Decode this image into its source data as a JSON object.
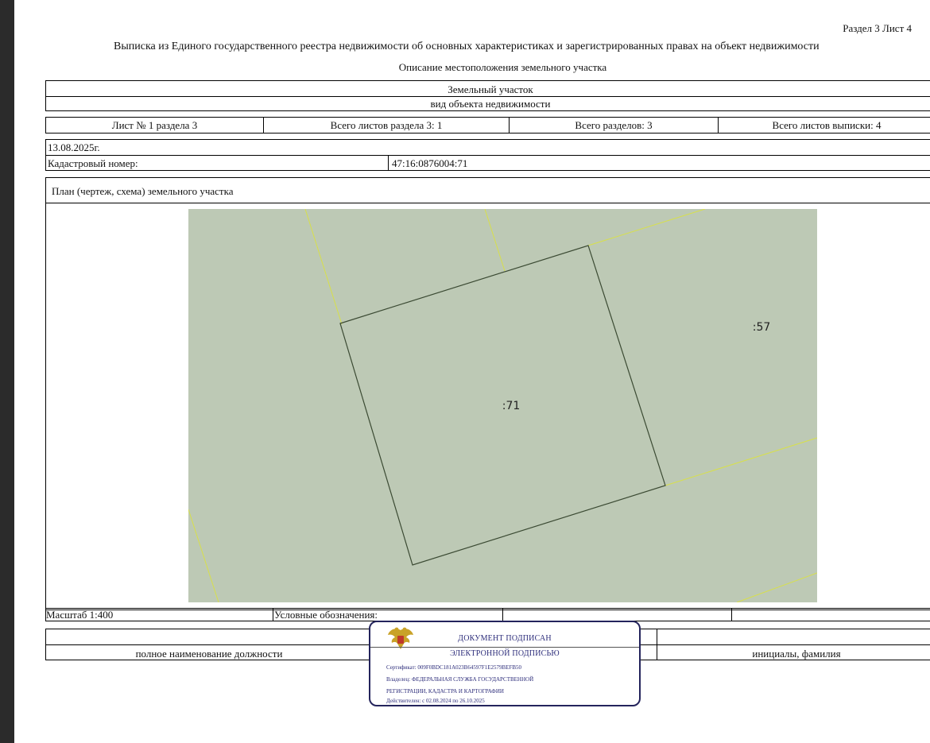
{
  "header": {
    "section_sheet": "Раздел 3   Лист 4",
    "title": "Выписка из Единого государственного реестра недвижимости об основных характеристиках и зарегистрированных правах на объект недвижимости",
    "subtitle": "Описание местоположения земельного участка"
  },
  "object": {
    "type": "Земельный участок",
    "type_caption": "вид объекта недвижимости"
  },
  "sheets": {
    "sheet_no": "Лист № 1 раздела 3",
    "total_section_sheets": "Всего листов раздела 3: 1",
    "total_sections": "Всего разделов: 3",
    "total_sheets": "Всего листов выписки: 4"
  },
  "date": "13.08.2025г.",
  "cadastral": {
    "label": "Кадастровый номер:",
    "value": "47:16:0876004:71"
  },
  "plan": {
    "title": "План (чертеж, схема) земельного участка",
    "parcel_main_label": ":71",
    "parcel_neighbor_label": ":57",
    "colors": {
      "map_fill": "#bdc9b5",
      "parcel_outline": "#3b4a33",
      "boundary_lines": "#d8e04a"
    }
  },
  "footer": {
    "scale": "Масштаб 1:400",
    "legend_label": "Условные обозначения:",
    "position_caption": "полное наименование должности",
    "name_caption": "инициалы, фамилия"
  },
  "stamp": {
    "emblem_icon": "double-headed-eagle-emblem",
    "line1": "ДОКУМЕНТ ПОДПИСАН",
    "line2": "ЭЛЕКТРОННОЙ ПОДПИСЬЮ",
    "certificate": "Сертификат: 009F0BDC181A023B64597F1E2579BEFB50",
    "owner_line1": "Владелец: ФЕДЕРАЛЬНАЯ СЛУЖБА ГОСУДАРСТВЕННОЙ",
    "owner_line2": "РЕГИСТРАЦИИ, КАДАСТРА И КАРТОГРАФИИ",
    "valid": "Действителен: с 02.08.2024 по 26.10.2025",
    "color": "#24245c"
  }
}
